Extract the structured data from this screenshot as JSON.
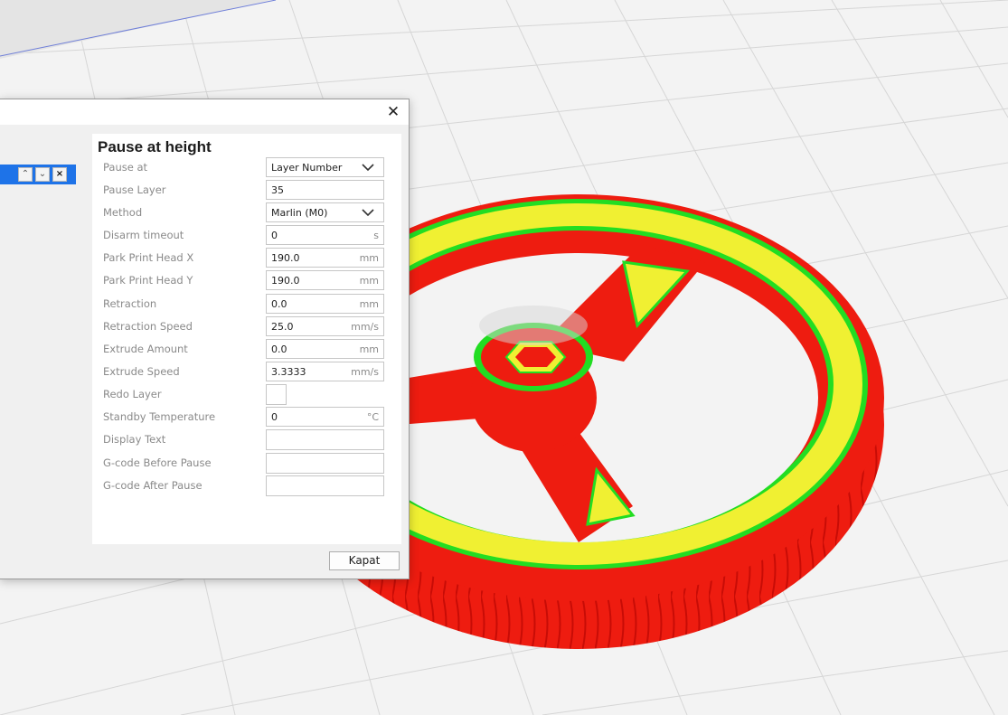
{
  "dialog": {
    "close_glyph": "✕",
    "panel_title": "Pause at height",
    "fields": [
      {
        "label": "Pause at",
        "value": "Layer Number",
        "unit": "",
        "kind": "select"
      },
      {
        "label": "Pause Layer",
        "value": "35",
        "unit": "",
        "kind": "text"
      },
      {
        "label": "Method",
        "value": "Marlin (M0)",
        "unit": "",
        "kind": "select"
      },
      {
        "label": "Disarm timeout",
        "value": "0",
        "unit": "s",
        "kind": "text"
      },
      {
        "label": "Park Print Head X",
        "value": "190.0",
        "unit": "mm",
        "kind": "text"
      },
      {
        "label": "Park Print Head Y",
        "value": "190.0",
        "unit": "mm",
        "kind": "text"
      },
      {
        "label": "Retraction",
        "value": "0.0",
        "unit": "mm",
        "kind": "text"
      },
      {
        "label": "Retraction Speed",
        "value": "25.0",
        "unit": "mm/s",
        "kind": "text"
      },
      {
        "label": "Extrude Amount",
        "value": "0.0",
        "unit": "mm",
        "kind": "text"
      },
      {
        "label": "Extrude Speed",
        "value": "3.3333",
        "unit": "mm/s",
        "kind": "text"
      },
      {
        "label": "Redo Layer",
        "value": "",
        "unit": "",
        "kind": "checkbox"
      },
      {
        "label": "Standby Temperature",
        "value": "0",
        "unit": "°C",
        "kind": "text"
      },
      {
        "label": "Display Text",
        "value": "",
        "unit": "",
        "kind": "text"
      },
      {
        "label": "G-code Before Pause",
        "value": "",
        "unit": "",
        "kind": "text"
      },
      {
        "label": "G-code After Pause",
        "value": "",
        "unit": "",
        "kind": "text"
      }
    ],
    "script_item_buttons": {
      "up": "⌃",
      "down": "⌄",
      "remove": "×"
    },
    "close_button_label": "Kapat"
  },
  "viewport": {
    "colors": {
      "wall": "#ee1c10",
      "infill": "#f0f032",
      "skin_edge": "#22dd22",
      "grid_bg": "#f4f4f4",
      "grid_line": "#d8d8d8"
    }
  }
}
